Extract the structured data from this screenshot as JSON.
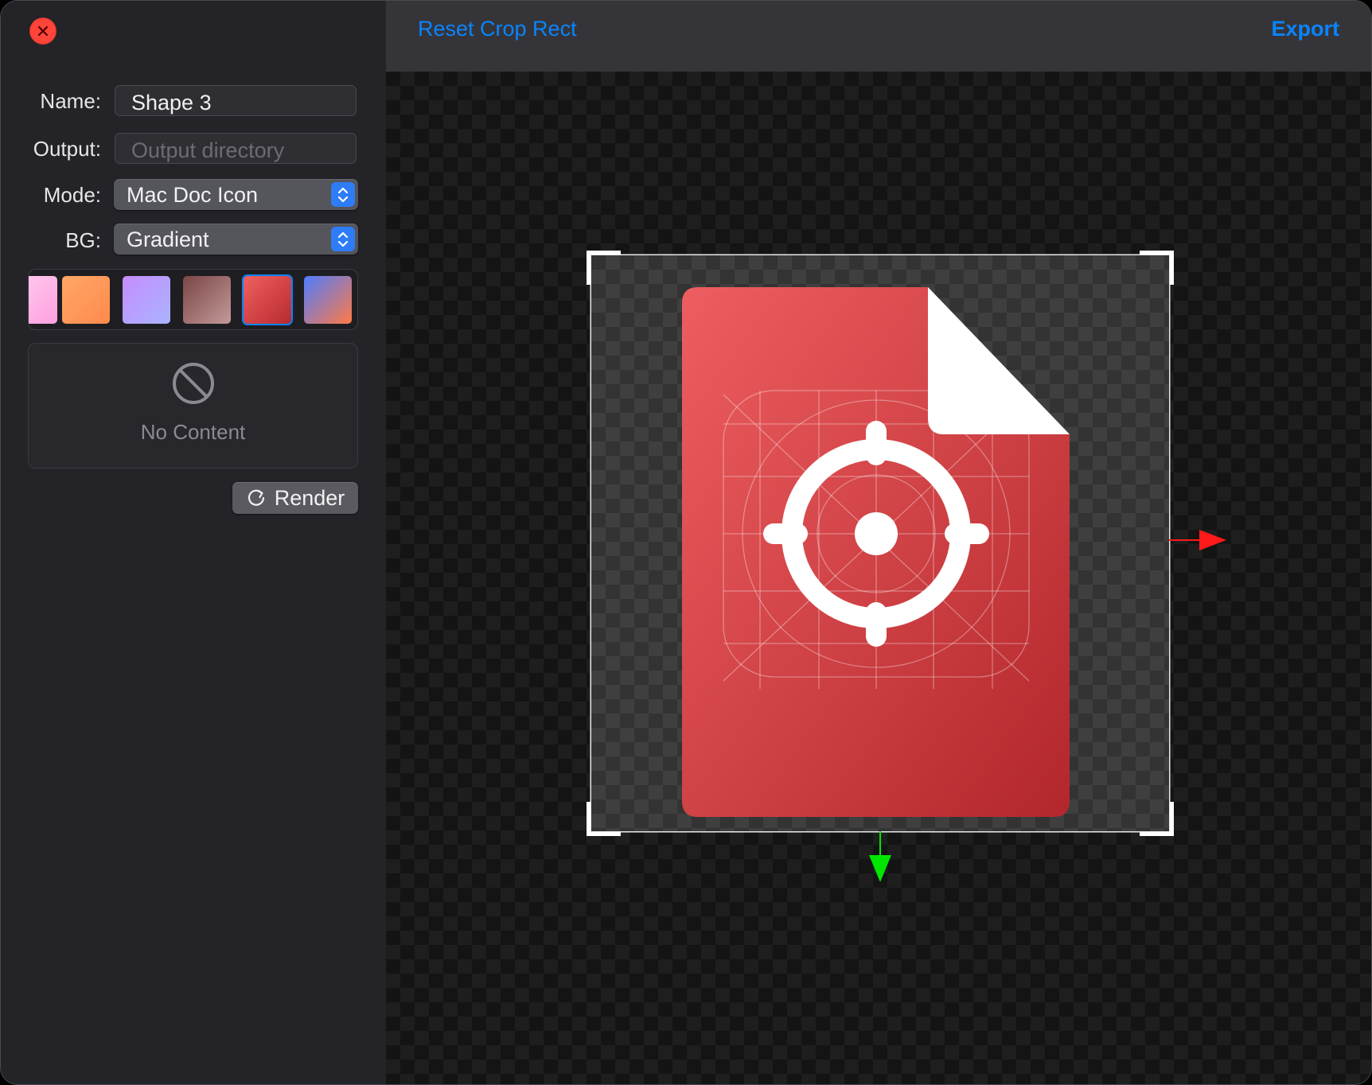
{
  "window": {
    "close_icon": "close-icon"
  },
  "form": {
    "name_label": "Name:",
    "name_value": "Shape 3",
    "output_label": "Output:",
    "output_value": "",
    "output_placeholder": "Output directory",
    "mode_label": "Mode:",
    "mode_value": "Mac Doc Icon",
    "bg_label": "BG:",
    "bg_value": "Gradient"
  },
  "swatches": [
    {
      "name": "pink",
      "colors": [
        "#ffd0f0",
        "#ff9fe0"
      ]
    },
    {
      "name": "orange",
      "colors": [
        "#ffa767",
        "#ff8a4c"
      ]
    },
    {
      "name": "lavender",
      "colors": [
        "#c58cff",
        "#a9b4ff"
      ]
    },
    {
      "name": "mauve",
      "colors": [
        "#7a4545",
        "#c49a9a"
      ]
    },
    {
      "name": "red",
      "colors": [
        "#f06060",
        "#b72a2e"
      ],
      "selected": true
    },
    {
      "name": "blue-orange",
      "colors": [
        "#4f7cff",
        "#ff7a45"
      ]
    }
  ],
  "preview": {
    "empty_icon": "prohibited-icon",
    "empty_label": "No Content"
  },
  "actions": {
    "render_label": "Render",
    "render_icon": "refresh-icon"
  },
  "toolbar": {
    "reset_label": "Reset Crop Rect",
    "export_label": "Export"
  },
  "canvas": {
    "document_icon": "document-crosshair-icon",
    "x_handle_color": "#ff1a1a",
    "y_handle_color": "#00e600"
  },
  "colors": {
    "accent": "#0a84ff",
    "close": "#ff453a"
  }
}
